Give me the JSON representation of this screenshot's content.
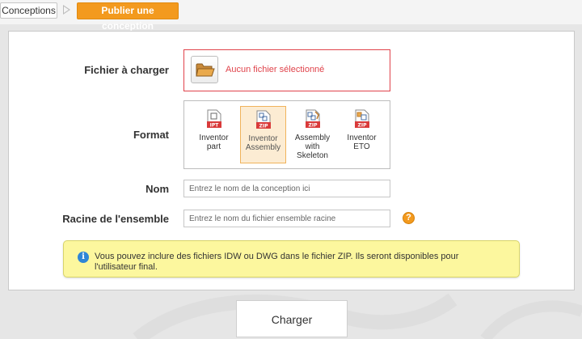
{
  "breadcrumb": {
    "root_label": "Conceptions",
    "active_label": "Publier une conception"
  },
  "form": {
    "file": {
      "label": "Fichier à charger",
      "status": "Aucun fichier sélectionné",
      "button_icon": "folder-icon"
    },
    "format": {
      "label": "Format",
      "options": [
        {
          "line1": "Inventor",
          "line2": "part",
          "line3": "",
          "badge": "IPT",
          "icon": "inventor-part-icon",
          "selected": false
        },
        {
          "line1": "Inventor",
          "line2": "Assembly",
          "line3": "",
          "badge": "ZIP",
          "icon": "inventor-assembly-icon",
          "selected": true
        },
        {
          "line1": "Assembly",
          "line2": "with",
          "line3": "Skeleton",
          "badge": "ZIP",
          "icon": "assembly-skeleton-icon",
          "selected": false
        },
        {
          "line1": "Inventor",
          "line2": "ETO",
          "line3": "",
          "badge": "ZIP",
          "icon": "inventor-eto-icon",
          "selected": false
        }
      ]
    },
    "name": {
      "label": "Nom",
      "placeholder": "Entrez le nom de la conception ici",
      "value": ""
    },
    "root": {
      "label": "Racine de l'ensemble",
      "placeholder": "Entrez le nom du fichier ensemble racine",
      "value": "",
      "help_glyph": "?"
    },
    "info": {
      "icon_glyph": "i",
      "text": "Vous pouvez inclure des fichiers IDW ou DWG dans le fichier ZIP. Ils seront disponibles pour l'utilisateur final."
    },
    "submit_label": "Charger"
  },
  "colors": {
    "accent": "#f39a1e",
    "error": "#e0434b",
    "info_bg": "#fcf79e",
    "selected_bg": "#fcecd3"
  }
}
